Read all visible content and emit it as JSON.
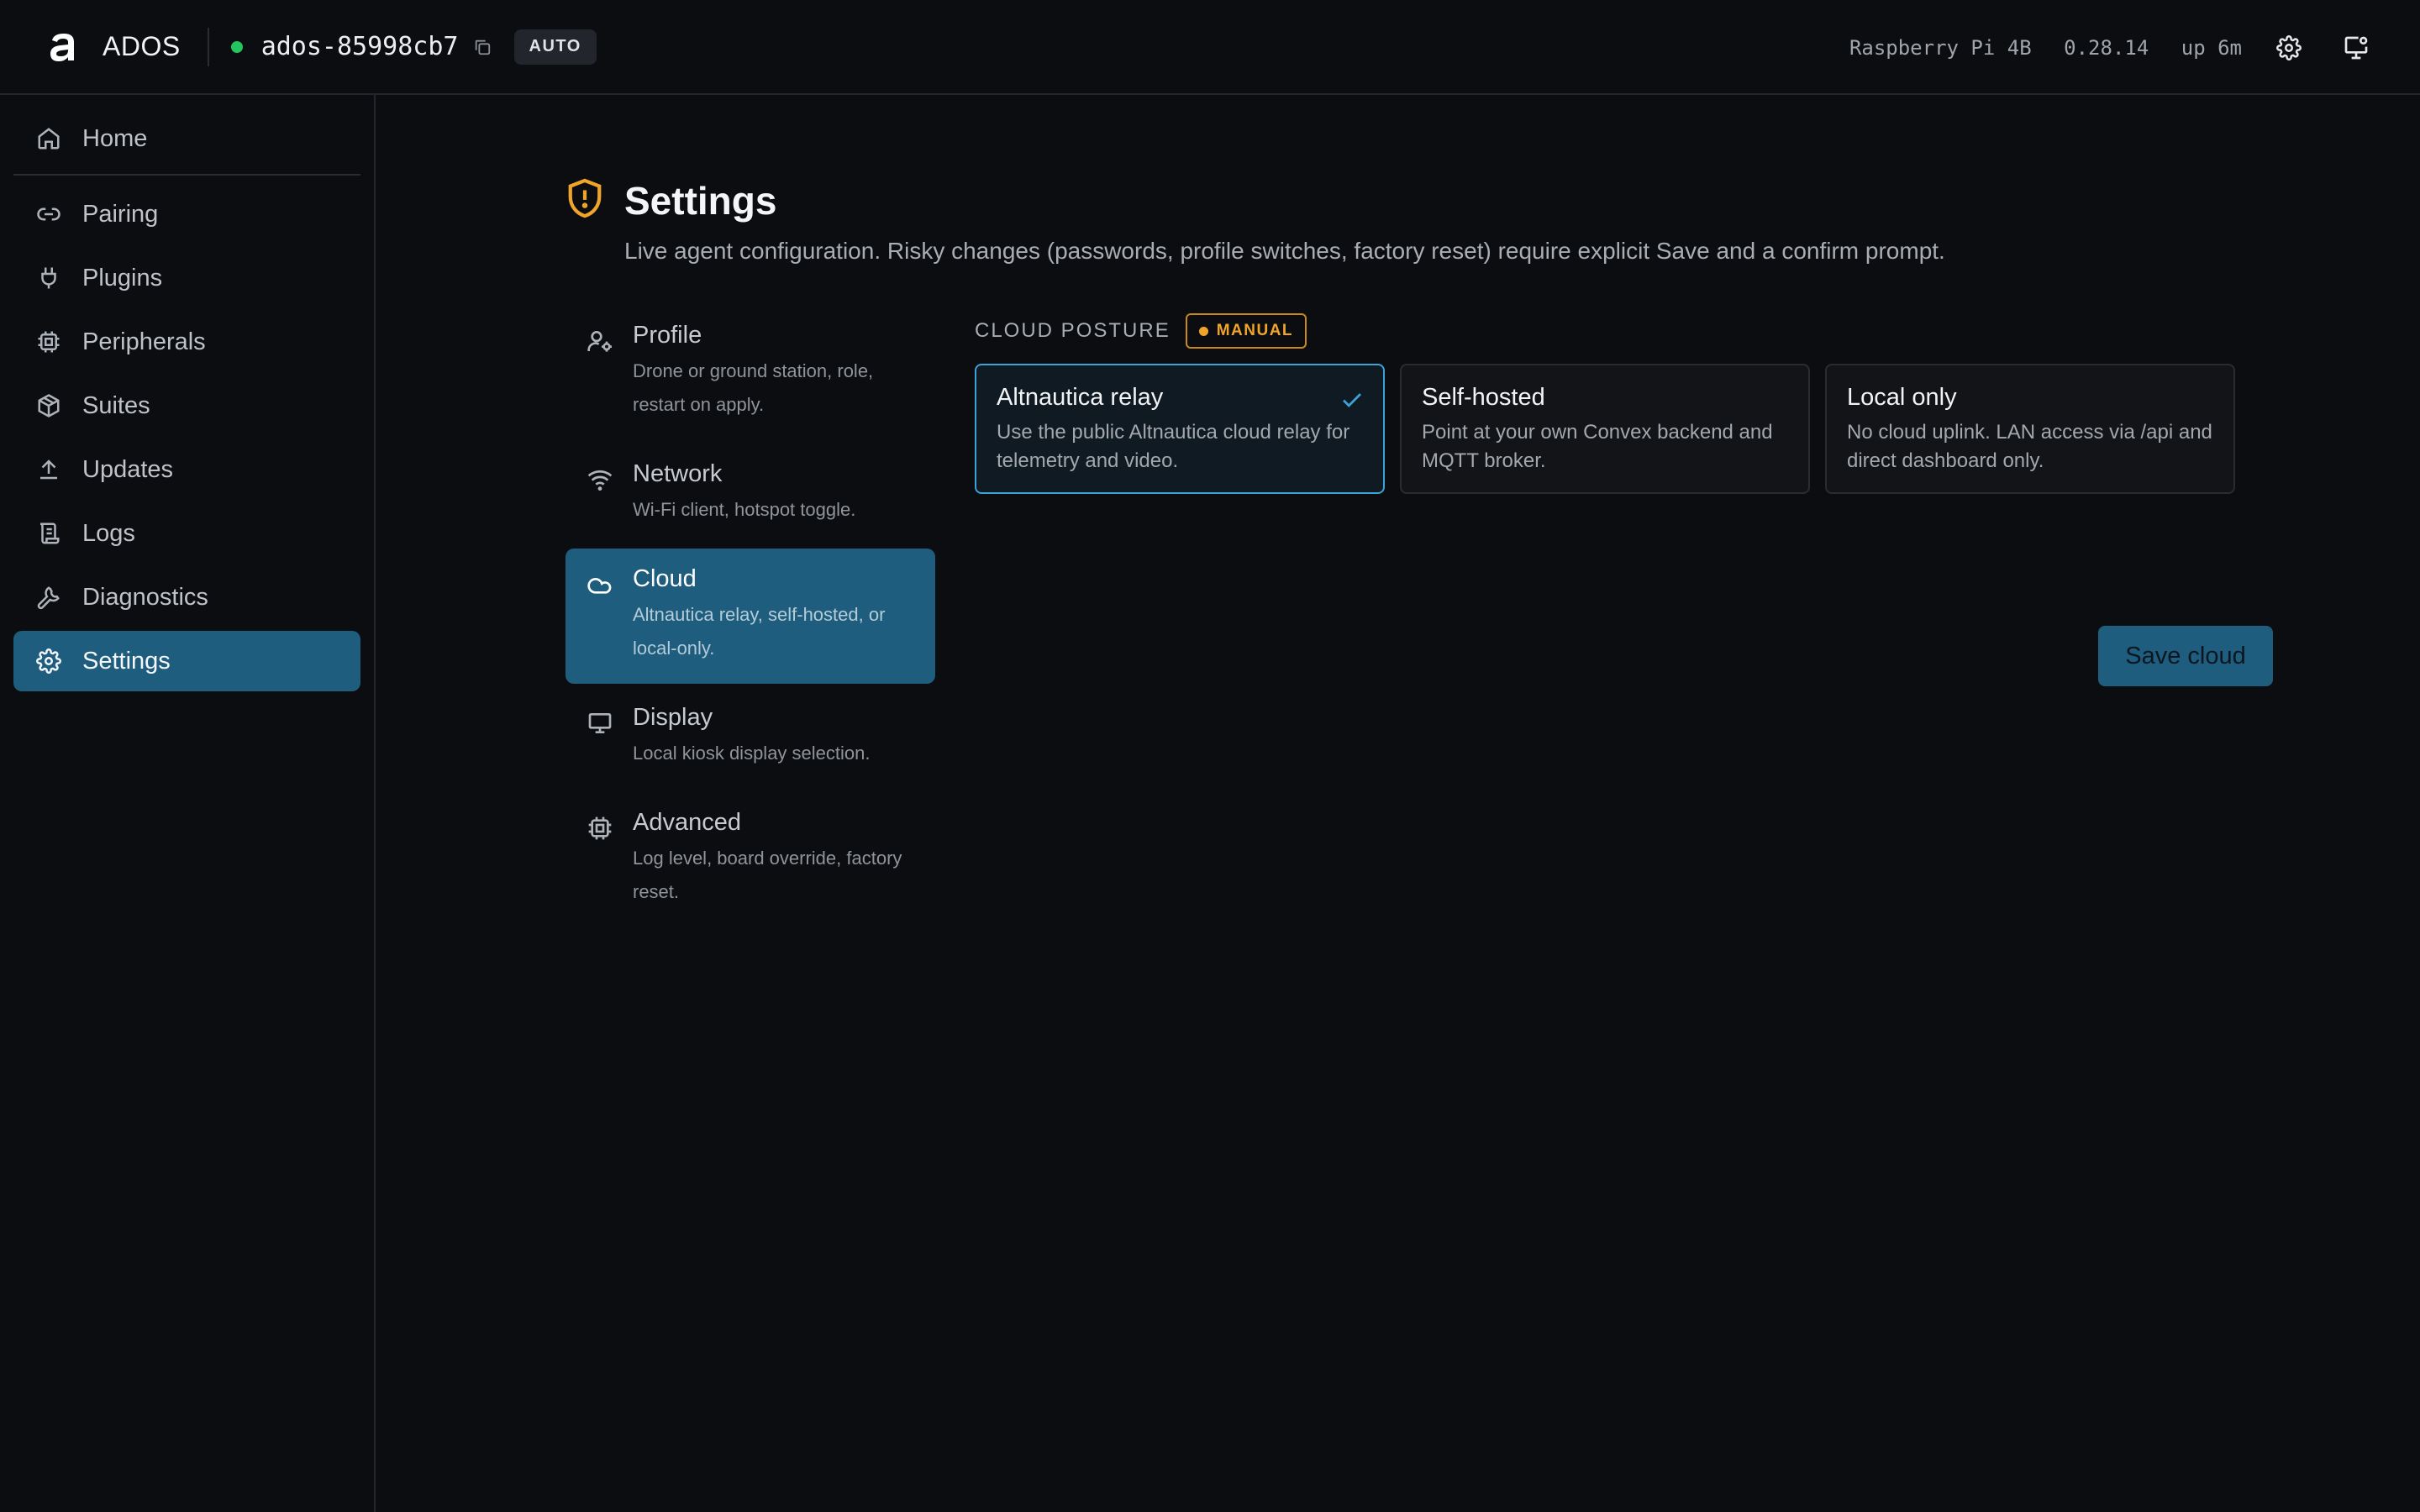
{
  "header": {
    "app_name": "ADOS",
    "device_id": "ados-85998cb7",
    "mode_badge": "AUTO",
    "board": "Raspberry Pi 4B",
    "version": "0.28.14",
    "uptime": "up 6m",
    "status_color": "#22c55e"
  },
  "sidebar": {
    "items": [
      {
        "label": "Home",
        "icon": "home-icon"
      },
      {
        "label": "Pairing",
        "icon": "link-icon"
      },
      {
        "label": "Plugins",
        "icon": "plug-icon"
      },
      {
        "label": "Peripherals",
        "icon": "chip-icon"
      },
      {
        "label": "Suites",
        "icon": "package-icon"
      },
      {
        "label": "Updates",
        "icon": "upload-icon"
      },
      {
        "label": "Logs",
        "icon": "scroll-icon"
      },
      {
        "label": "Diagnostics",
        "icon": "wrench-icon"
      },
      {
        "label": "Settings",
        "icon": "gear-icon",
        "active": true
      }
    ]
  },
  "page": {
    "title": "Settings",
    "subtitle": "Live agent configuration. Risky changes (passwords, profile switches, factory reset) require explicit Save and a confirm prompt."
  },
  "subnav": [
    {
      "title": "Profile",
      "desc": "Drone or ground station, role, restart on apply.",
      "icon": "user-settings-icon"
    },
    {
      "title": "Network",
      "desc": "Wi-Fi client, hotspot toggle.",
      "icon": "wifi-icon"
    },
    {
      "title": "Cloud",
      "desc": "Altnautica relay, self-hosted, or local-only.",
      "icon": "cloud-icon",
      "active": true
    },
    {
      "title": "Display",
      "desc": "Local kiosk display selection.",
      "icon": "monitor-icon"
    },
    {
      "title": "Advanced",
      "desc": "Log level, board override, factory reset.",
      "icon": "cpu-icon"
    }
  ],
  "cloud": {
    "section_label": "CLOUD POSTURE",
    "badge": "MANUAL",
    "options": [
      {
        "title": "Altnautica relay",
        "desc": "Use the public Altnautica cloud relay for telemetry and video.",
        "selected": true
      },
      {
        "title": "Self-hosted",
        "desc": "Point at your own Convex backend and MQTT broker."
      },
      {
        "title": "Local only",
        "desc": "No cloud uplink. LAN access via /api and direct dashboard only."
      }
    ],
    "save_label": "Save cloud"
  },
  "colors": {
    "accent": "#1e5d7d",
    "selected_border": "#3ba3d8",
    "warning": "#f0a52a"
  }
}
